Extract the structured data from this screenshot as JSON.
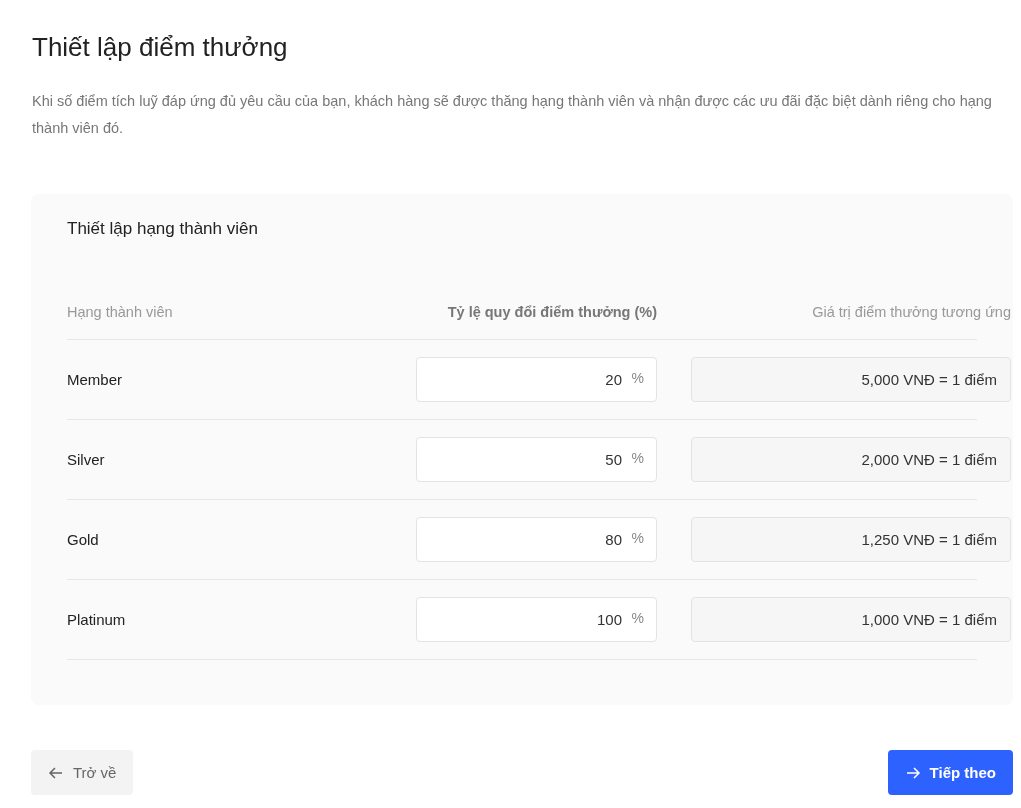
{
  "title": "Thiết lập điểm thưởng",
  "description": "Khi số điểm tích luỹ đáp ứng đủ yêu cầu của bạn, khách hàng sẽ được thăng hạng thành viên và nhận được các ưu đãi đặc biệt dành riêng cho hạng thành viên đó.",
  "card": {
    "title": "Thiết lập hạng thành viên",
    "columns": [
      "Hạng thành viên",
      "Tỷ lệ quy đổi điểm thưởng (%)",
      "Giá trị điểm thưởng tương ứng"
    ],
    "rows": [
      {
        "tier": "Member",
        "rate": "20",
        "unit": "%",
        "value": "5,000 VNĐ = 1 điểm"
      },
      {
        "tier": "Silver",
        "rate": "50",
        "unit": "%",
        "value": "2,000 VNĐ = 1 điểm"
      },
      {
        "tier": "Gold",
        "rate": "80",
        "unit": "%",
        "value": "1,250 VNĐ = 1 điểm"
      },
      {
        "tier": "Platinum",
        "rate": "100",
        "unit": "%",
        "value": "1,000 VNĐ = 1 điểm"
      }
    ]
  },
  "buttons": {
    "back": "Trở về",
    "next": "Tiếp theo"
  }
}
